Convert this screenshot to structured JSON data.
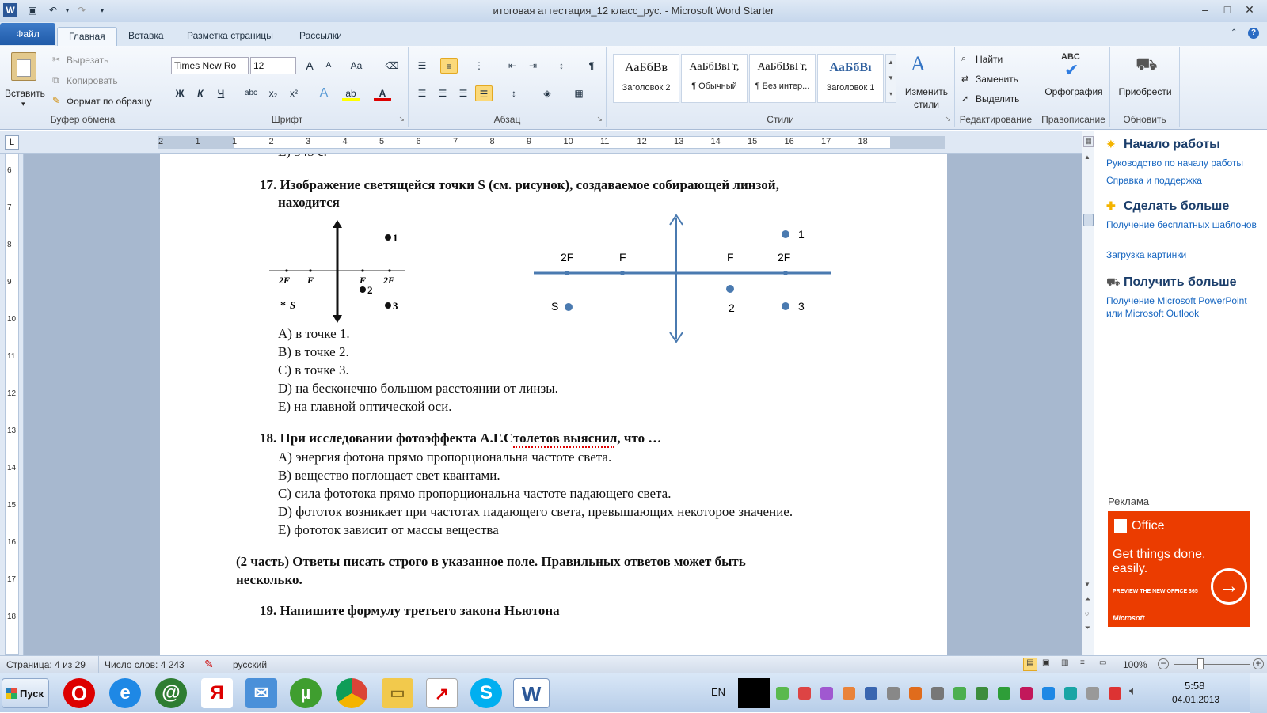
{
  "window": {
    "title": "итоговая аттестация_12 класс_рус. - Microsoft Word Starter",
    "app_icon": "W"
  },
  "quick_access": [
    "save-icon",
    "undo-icon",
    "redo-icon",
    "customize-icon"
  ],
  "window_buttons": {
    "minimize": "–",
    "maximize": "□",
    "close": "✕"
  },
  "tabs": {
    "file": "Файл",
    "home": "Главная",
    "insert": "Вставка",
    "layout": "Разметка страницы",
    "mailings": "Рассылки"
  },
  "ribbon": {
    "clipboard": {
      "label": "Буфер обмена",
      "paste": "Вставить",
      "cut": "Вырезать",
      "copy": "Копировать",
      "format_painter": "Формат по образцу"
    },
    "font": {
      "label": "Шрифт",
      "family": "Times New Ro",
      "size": "12",
      "grow": "A",
      "shrink": "A",
      "case": "Aa",
      "bold": "Ж",
      "italic": "К",
      "underline": "Ч",
      "strike": "abc",
      "sub": "x₂",
      "sup": "x²",
      "effects": "A",
      "highlight": "ab",
      "color": "A"
    },
    "paragraph": {
      "label": "Абзац",
      "pilcrow": "¶"
    },
    "styles": {
      "label": "Стили",
      "items": [
        {
          "sample": "АаБбВв",
          "name": "Заголовок 2"
        },
        {
          "sample": "АаБбВвГг,",
          "name": "¶ Обычный"
        },
        {
          "sample": "АаБбВвГг,",
          "name": "¶ Без интер..."
        },
        {
          "sample": "АаБбВı",
          "name": "Заголовок 1"
        }
      ],
      "change": "Изменить стили"
    },
    "editing": {
      "label": "Редактирование",
      "find": "Найти",
      "replace": "Заменить",
      "select": "Выделить"
    },
    "proofing": {
      "label": "Правописание",
      "spelling": "Орфография",
      "abc": "ABC"
    },
    "update": {
      "label": "Обновить",
      "buy": "Приобрести"
    }
  },
  "ruler": {
    "h_ticks": [
      "2",
      "1",
      "1",
      "2",
      "3",
      "4",
      "5",
      "6",
      "7",
      "8",
      "9",
      "10",
      "11",
      "12",
      "13",
      "14",
      "15",
      "16",
      "17",
      "18"
    ],
    "v_ticks": [
      "6",
      "7",
      "8",
      "9",
      "10",
      "11",
      "12",
      "13",
      "14",
      "15",
      "16",
      "17",
      "18"
    ]
  },
  "document": {
    "prev_line": "E) 345 c.",
    "q17": {
      "line1": "17. Изображение светящейся точки S (см. рисунок), создаваемое собирающей линзой,",
      "line2": "находится",
      "fig_small": {
        "p1": "1",
        "p2": "2",
        "p3": "3",
        "s": "S",
        "l2f": "2F",
        "lf": "F",
        "rf": "F",
        "r2f": "2F"
      },
      "fig_large": {
        "p1": "1",
        "p2": "2",
        "p3": "3",
        "s": "S",
        "l2f": "2F",
        "lf": "F",
        "rf": "F",
        "r2f": "2F"
      },
      "options": [
        "A) в точке 1.",
        "B) в точке 2.",
        "C) в точке 3.",
        "D) на бесконечно большом расстоянии от линзы.",
        "E) на главной оптической оси."
      ]
    },
    "q18": {
      "q": "18. При исследовании фотоэффекта А.Г.Столетов выяснил, что …",
      "options": [
        "A) энергия фотона прямо пропорциональна частоте света.",
        "B) вещество поглощает свет квантами.",
        "C) сила фототока прямо пропорциональна частоте падающего света.",
        "D) фототок возникает при частотах падающего света, превышающих некоторое значение.",
        "E) фототок зависит от массы вещества"
      ]
    },
    "part2": {
      "line1": "(2 часть)  Ответы писать строго в указанное поле. Правильных ответов может быть",
      "line2": "несколько."
    },
    "q19": "19. Напишите формулу третьего закона   Ньютона"
  },
  "pane": {
    "h1": "Начало работы",
    "l1": "Руководство по началу работы",
    "l2": "Справка и поддержка",
    "h2": "Сделать больше",
    "l3": "Получение бесплатных шаблонов",
    "l4": "Загрузка картинки",
    "h3": "Получить больше",
    "l5": "Получение Microsoft PowerPoint или Microsoft Outlook",
    "ad_label": "Реклама",
    "ad": {
      "brand": "Office",
      "slogan": "Get things done, easily.",
      "cta": "PREVIEW THE NEW OFFICE 365",
      "maker": "Microsoft",
      "color": "#eb3c00"
    }
  },
  "status": {
    "page": "Страница: 4 из 29",
    "words": "Число слов: 4 243",
    "lang": "русский",
    "zoom": "100%"
  },
  "taskbar": {
    "start": "Пуск",
    "apps": [
      "opera-icon",
      "ie-icon",
      "mail-at-icon",
      "yandex-icon",
      "mail-icon",
      "utorrent-icon",
      "chrome-icon",
      "folder-icon",
      "chart-app-icon",
      "skype-icon",
      "word-icon"
    ],
    "lang": "EN",
    "time": "5:58",
    "date": "04.01.2013"
  }
}
